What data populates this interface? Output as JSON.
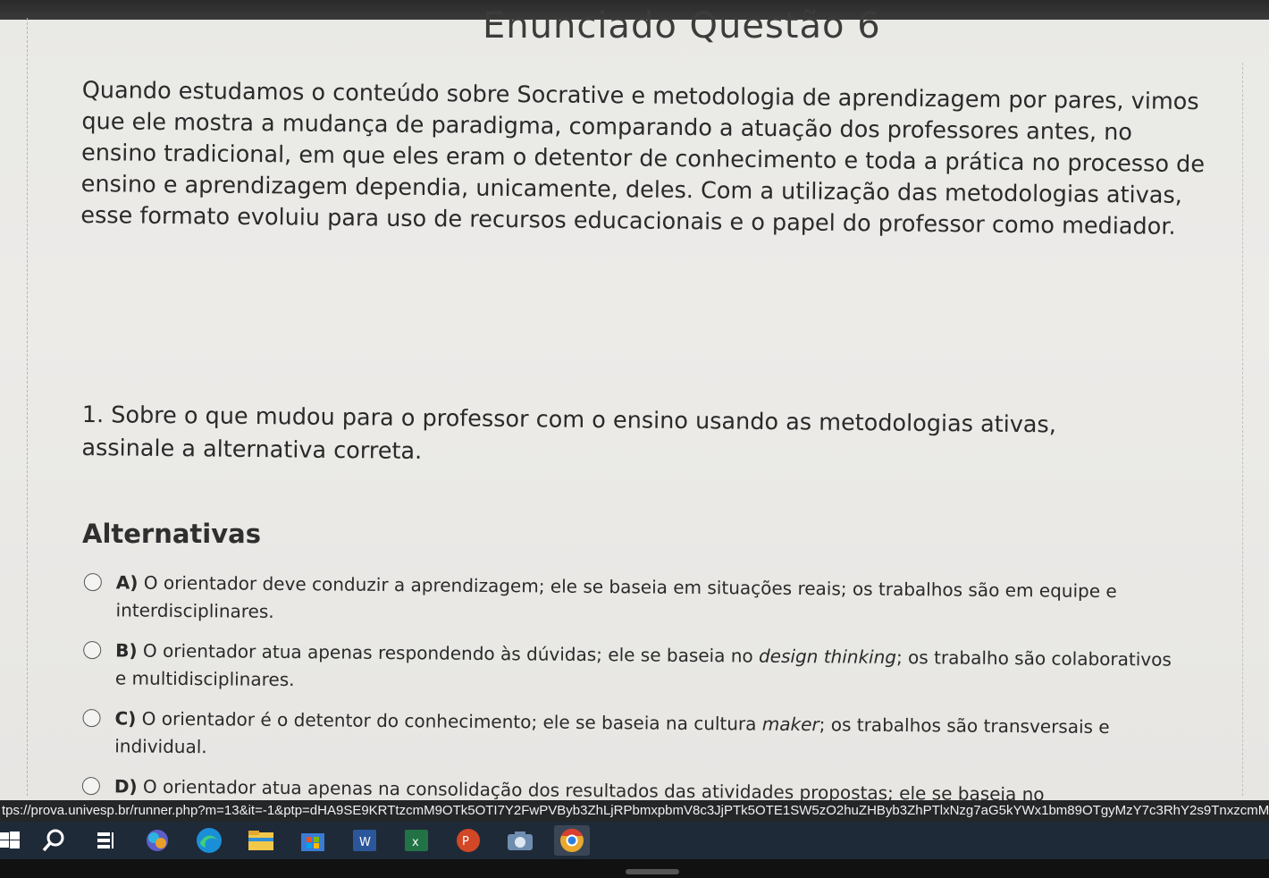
{
  "header": {
    "title": "Enunciado Questão 6"
  },
  "statement": {
    "text": "Quando estudamos o conteúdo sobre Socrative e metodologia de aprendizagem por pares, vimos que ele mostra a mudança de paradigma, comparando a atuação dos professores antes, no ensino tradicional, em que eles eram o detentor de conhecimento e toda a prática no processo de ensino e aprendizagem dependia, unicamente, deles. Com a utilização das metodologias ativas, esse formato evoluiu para uso de recursos educacionais e o papel do professor como mediador."
  },
  "question": {
    "text": "1. Sobre o que mudou para o professor com o ensino usando as metodologias ativas, assinale a alternativa correta."
  },
  "alternatives": {
    "heading": "Alternativas",
    "items": [
      {
        "letter": "A)",
        "text": "O orientador deve conduzir a aprendizagem; ele se baseia em situações reais; os trabalhos são em equipe e interdisciplinares."
      },
      {
        "letter": "B)",
        "text_before": "O orientador atua apenas respondendo às dúvidas; ele se baseia no ",
        "text_italic": "design thinking",
        "text_after": "; os trabalho são colaborativos e multidisciplinares."
      },
      {
        "letter": "C)",
        "text_before": "O orientador é o detentor do conhecimento; ele se baseia na cultura ",
        "text_italic": "maker",
        "text_after": "; os trabalhos são transversais e individual."
      },
      {
        "letter": "D)",
        "text": "O orientador atua apenas na consolidação dos resultados das atividades propostas; ele se baseia no"
      }
    ]
  },
  "status": {
    "url": "tps://prova.univesp.br/runner.php?m=13&it=-1&ptp=dHA9SE9KRTtzcmM9OTk5OTI7Y2FwPVByb3ZhLjRPbmxpbmV8c3JjPTk5OTE1SW5zO2huZHByb3ZhPTlxNzg7aG5kYWx1bm89OTgyMzY7c3RhY2s9TnxzcmM9OTk5MTU7aG5kYW"
  },
  "taskbar": {
    "icons": [
      "windows-start-icon",
      "search-icon",
      "task-view-icon",
      "teams-icon",
      "edge-icon",
      "file-explorer-icon",
      "store-icon",
      "word-icon",
      "excel-icon",
      "powerpoint-icon",
      "camera-icon",
      "chrome-icon"
    ]
  }
}
